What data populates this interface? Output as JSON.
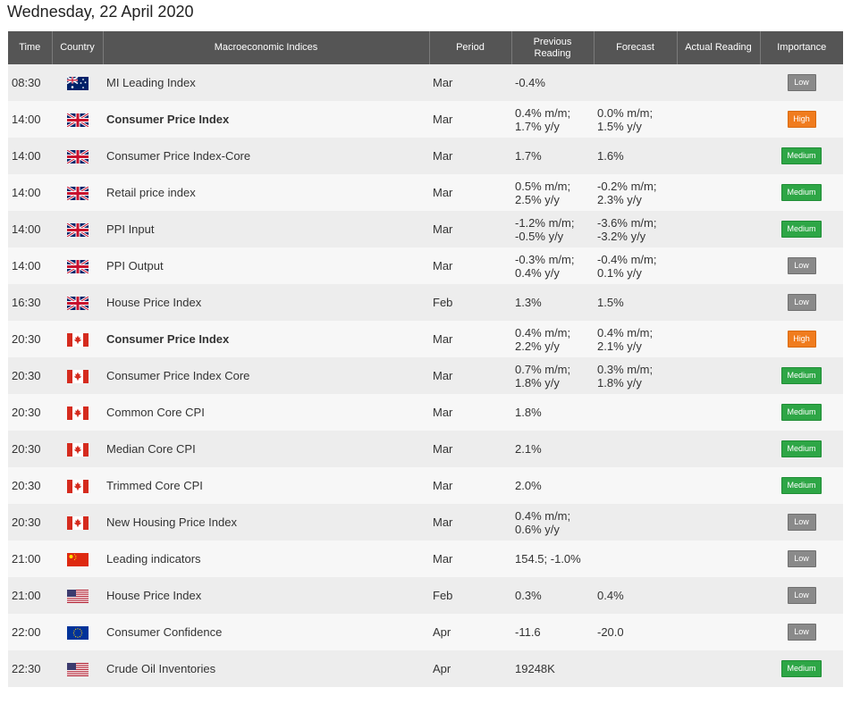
{
  "page": {
    "title": "Wednesday, 22 April 2020"
  },
  "columns": {
    "time": "Time",
    "country": "Country",
    "indices": "Macroeconomic Indices",
    "period": "Period",
    "previous": "Previous\nReading",
    "forecast": "Forecast",
    "actual": "Actual Reading",
    "importance": "Importance"
  },
  "colors": {
    "header_bg": "#555555",
    "row_odd": "#ededed",
    "row_even": "#f7f7f7",
    "low": "#8a8a8a",
    "high": "#f07c1e",
    "medium": "#2ea646"
  },
  "rows": [
    {
      "time": "08:30",
      "flag": "australia-flag-icon",
      "name": "MI Leading Index",
      "bold": false,
      "period": "Mar",
      "previous": "-0.4%",
      "forecast": "",
      "actual": "",
      "importance": "Low"
    },
    {
      "time": "14:00",
      "flag": "uk-flag-icon",
      "name": "Consumer Price Index",
      "bold": true,
      "period": "Mar",
      "previous": "0.4% m/m;\n1.7% y/y",
      "forecast": "0.0% m/m;\n1.5% y/y",
      "actual": "",
      "importance": "High"
    },
    {
      "time": "14:00",
      "flag": "uk-flag-icon",
      "name": "Consumer Price Index-Core",
      "bold": false,
      "period": "Mar",
      "previous": "1.7%",
      "forecast": "1.6%",
      "actual": "",
      "importance": "Medium"
    },
    {
      "time": "14:00",
      "flag": "uk-flag-icon",
      "name": "Retail price index",
      "bold": false,
      "period": "Mar",
      "previous": "0.5% m/m;\n2.5% y/y",
      "forecast": "-0.2% m/m;\n2.3% y/y",
      "actual": "",
      "importance": "Medium"
    },
    {
      "time": "14:00",
      "flag": "uk-flag-icon",
      "name": "PPI Input",
      "bold": false,
      "period": "Mar",
      "previous": "-1.2% m/m;\n-0.5% y/y",
      "forecast": "-3.6% m/m;\n-3.2% y/y",
      "actual": "",
      "importance": "Medium"
    },
    {
      "time": "14:00",
      "flag": "uk-flag-icon",
      "name": "PPI Output",
      "bold": false,
      "period": "Mar",
      "previous": "-0.3% m/m;\n0.4% y/y",
      "forecast": "-0.4% m/m;\n0.1% y/y",
      "actual": "",
      "importance": "Low"
    },
    {
      "time": "16:30",
      "flag": "uk-flag-icon",
      "name": "House Price Index",
      "bold": false,
      "period": "Feb",
      "previous": "1.3%",
      "forecast": "1.5%",
      "actual": "",
      "importance": "Low"
    },
    {
      "time": "20:30",
      "flag": "canada-flag-icon",
      "name": "Consumer Price Index",
      "bold": true,
      "period": "Mar",
      "previous": "0.4% m/m;\n2.2% y/y",
      "forecast": "0.4% m/m;\n2.1% y/y",
      "actual": "",
      "importance": "High"
    },
    {
      "time": "20:30",
      "flag": "canada-flag-icon",
      "name": "Consumer Price Index Core",
      "bold": false,
      "period": "Mar",
      "previous": "0.7% m/m;\n1.8% y/y",
      "forecast": "0.3% m/m;\n1.8% y/y",
      "actual": "",
      "importance": "Medium"
    },
    {
      "time": "20:30",
      "flag": "canada-flag-icon",
      "name": "Common Core CPI",
      "bold": false,
      "period": "Mar",
      "previous": "1.8%",
      "forecast": "",
      "actual": "",
      "importance": "Medium"
    },
    {
      "time": "20:30",
      "flag": "canada-flag-icon",
      "name": "Median Core CPI",
      "bold": false,
      "period": "Mar",
      "previous": "2.1%",
      "forecast": "",
      "actual": "",
      "importance": "Medium"
    },
    {
      "time": "20:30",
      "flag": "canada-flag-icon",
      "name": "Trimmed Core CPI",
      "bold": false,
      "period": "Mar",
      "previous": "2.0%",
      "forecast": "",
      "actual": "",
      "importance": "Medium"
    },
    {
      "time": "20:30",
      "flag": "canada-flag-icon",
      "name": "New Housing Price Index",
      "bold": false,
      "period": "Mar",
      "previous": "0.4% m/m;\n0.6% y/y",
      "forecast": "",
      "actual": "",
      "importance": "Low"
    },
    {
      "time": "21:00",
      "flag": "china-flag-icon",
      "name": "Leading indicators",
      "bold": false,
      "period": "Mar",
      "previous": "154.5; -1.0%",
      "forecast": "",
      "actual": "",
      "importance": "Low"
    },
    {
      "time": "21:00",
      "flag": "usa-flag-icon",
      "name": "House Price Index",
      "bold": false,
      "period": "Feb",
      "previous": "0.3%",
      "forecast": "0.4%",
      "actual": "",
      "importance": "Low"
    },
    {
      "time": "22:00",
      "flag": "eu-flag-icon",
      "name": "Consumer Confidence",
      "bold": false,
      "period": "Apr",
      "previous": "-11.6",
      "forecast": "-20.0",
      "actual": "",
      "importance": "Low"
    },
    {
      "time": "22:30",
      "flag": "usa-flag-icon",
      "name": "Crude Oil Inventories",
      "bold": false,
      "period": "Apr",
      "previous": "19248K",
      "forecast": "",
      "actual": "",
      "importance": "Medium"
    }
  ]
}
